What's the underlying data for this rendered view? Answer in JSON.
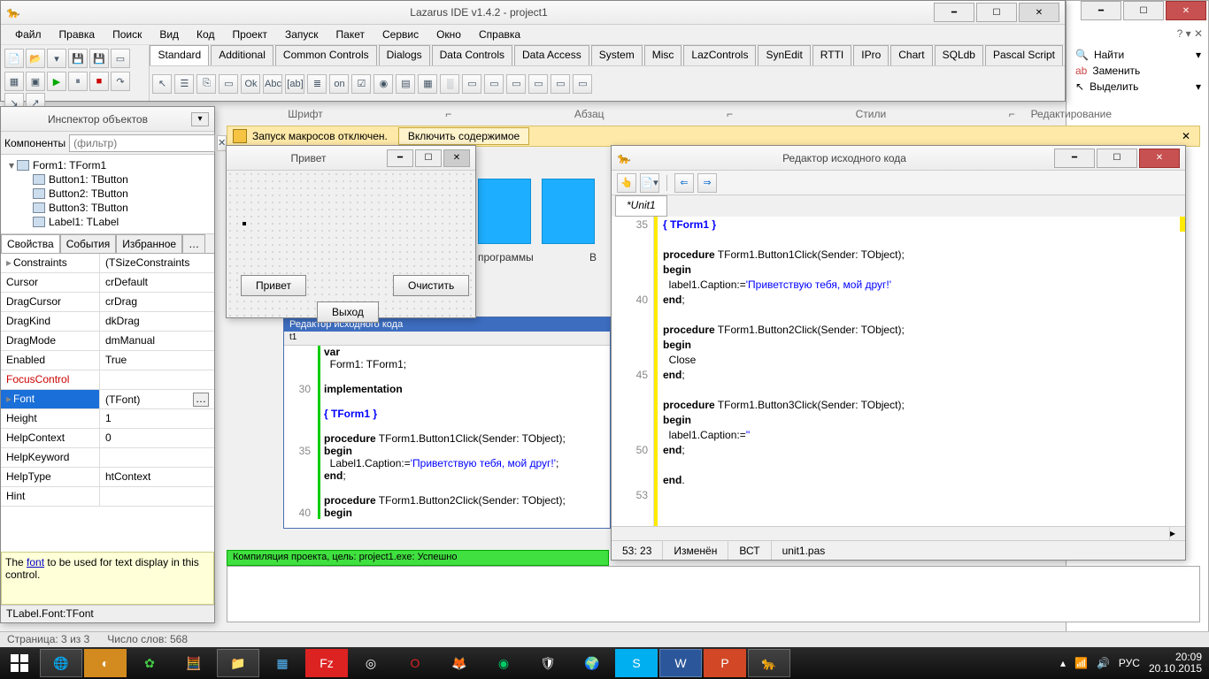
{
  "lazarus": {
    "title": "Lazarus IDE v1.4.2 - project1",
    "menu": [
      "Файл",
      "Правка",
      "Поиск",
      "Вид",
      "Код",
      "Проект",
      "Запуск",
      "Пакет",
      "Сервис",
      "Окно",
      "Справка"
    ],
    "comp_tabs": [
      "Standard",
      "Additional",
      "Common Controls",
      "Dialogs",
      "Data Controls",
      "Data Access",
      "System",
      "Misc",
      "LazControls",
      "SynEdit",
      "RTTI",
      "IPro",
      "Chart",
      "SQLdb",
      "Pascal Script"
    ],
    "palette_icons": [
      "↖",
      "☰",
      "⎘",
      "▭",
      "Ok",
      "Abc",
      "[ab]",
      "≣",
      "on",
      "☑",
      "◉",
      "▤",
      "▦",
      "░",
      "▭",
      "▭",
      "▭",
      "▭",
      "▭",
      "▭"
    ]
  },
  "inspector": {
    "title": "Инспектор объектов",
    "comp_label": "Компоненты",
    "filter_ph": "(фильтр)",
    "tree": [
      {
        "indent": 0,
        "label": "Form1: TForm1",
        "exp": "▾"
      },
      {
        "indent": 1,
        "label": "Button1: TButton"
      },
      {
        "indent": 1,
        "label": "Button2: TButton"
      },
      {
        "indent": 1,
        "label": "Button3: TButton"
      },
      {
        "indent": 1,
        "label": "Label1: TLabel"
      }
    ],
    "ptabs": [
      "Свойства",
      "События",
      "Избранное",
      "…"
    ],
    "props": [
      {
        "n": "Constraints",
        "v": "(TSizeConstraints",
        "arrow": "▸"
      },
      {
        "n": "Cursor",
        "v": "crDefault"
      },
      {
        "n": "DragCursor",
        "v": "crDrag"
      },
      {
        "n": "DragKind",
        "v": "dkDrag"
      },
      {
        "n": "DragMode",
        "v": "dmManual"
      },
      {
        "n": "Enabled",
        "v": "True"
      },
      {
        "n": "FocusControl",
        "v": "",
        "focus": true
      },
      {
        "n": "Font",
        "v": "(TFont)",
        "sel": true,
        "arrow": "▸"
      },
      {
        "n": "Height",
        "v": "1"
      },
      {
        "n": "HelpContext",
        "v": "0"
      },
      {
        "n": "HelpKeyword",
        "v": ""
      },
      {
        "n": "HelpType",
        "v": "htContext"
      },
      {
        "n": "Hint",
        "v": ""
      }
    ],
    "help_pre": "The ",
    "help_link": "font",
    "help_post": " to be used for text display in this control.",
    "status": "TLabel.Font:TFont"
  },
  "form_design": {
    "title": "Привет",
    "btn1": "Привет",
    "btn2": "Очистить",
    "btn3": "Выход"
  },
  "editor": {
    "title": "Редактор исходного кода",
    "tab": "*Unit1",
    "gutter": [
      "35",
      "",
      "",
      "",
      "",
      "40",
      "",
      "",
      "",
      "",
      "45",
      "",
      "",
      "",
      "",
      "50",
      "",
      "",
      "53"
    ],
    "status_pos": "53: 23",
    "status_mod": "Изменён",
    "status_ins": "ВСТ",
    "status_file": "unit1.pas"
  },
  "bg_editor": {
    "title": "Редактор исходного кода",
    "gutter": [
      "",
      "",
      "",
      "30",
      "",
      "",
      "",
      "",
      "35",
      "",
      "",
      "",
      "",
      "40"
    ]
  },
  "ribbon_groups": [
    "Шрифт",
    "Абзац",
    "Стили",
    "Редактирование"
  ],
  "ribbon_right": {
    "find": "Найти",
    "replace": "Заменить",
    "select": "Выделить"
  },
  "macrobar": {
    "text": "Запуск макросов отключен.",
    "btn": "Включить содержимое"
  },
  "bg_labels": {
    "prog": "программы",
    "in": "В"
  },
  "compile_msg": "Компиляция проекта, цель: project1.exe: Успешно",
  "word_status": {
    "page": "Страница: 3 из 3",
    "words": "Число слов: 568"
  },
  "tray": {
    "lang": "РУС",
    "time": "20:09",
    "date": "20.10.2015"
  }
}
